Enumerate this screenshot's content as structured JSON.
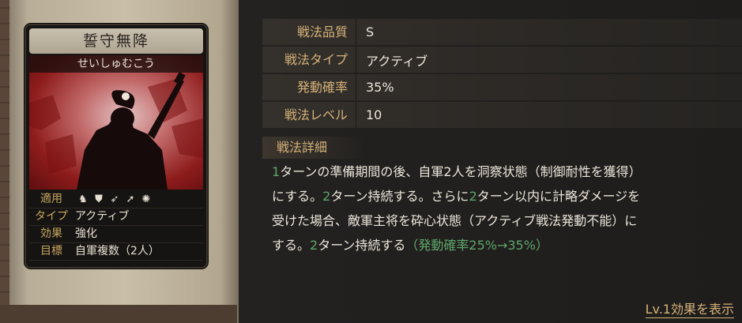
{
  "card": {
    "name": "誓守無降",
    "reading": "せいしゅむこう",
    "rows": [
      {
        "key": "適用",
        "icons": [
          "cavalry-icon",
          "shield-icon",
          "bow-icon",
          "spear-icon",
          "wheel-icon"
        ]
      },
      {
        "key": "タイプ",
        "value": "アクティブ"
      },
      {
        "key": "効果",
        "value": "強化"
      },
      {
        "key": "目標",
        "value": "自軍複数（2人）"
      }
    ]
  },
  "stats": [
    {
      "key": "戦法品質",
      "value": "S"
    },
    {
      "key": "戦法タイプ",
      "value": "アクティブ"
    },
    {
      "key": "発動確率",
      "value": "35%"
    },
    {
      "key": "戦法レベル",
      "value": "10"
    }
  ],
  "detail": {
    "heading": "戦法詳細",
    "segments": [
      {
        "text": "1",
        "hl": true
      },
      {
        "text": "ターンの準備期間の後、自軍2人を洞察状態（制御耐性を獲得）",
        "hl": false
      },
      {
        "text": "にする。",
        "hl": false
      },
      {
        "text": "2",
        "hl": true
      },
      {
        "text": "ターン持続する。さらに",
        "hl": false
      },
      {
        "text": "2",
        "hl": true
      },
      {
        "text": "ターン以内に計略ダメージを",
        "hl": false
      },
      {
        "text": "受けた場合、敵軍主将を砕心状態（アクティブ戦法発動不能）に",
        "hl": false
      },
      {
        "text": "する。",
        "hl": false
      },
      {
        "text": "2",
        "hl": true
      },
      {
        "text": "ターン持続する",
        "hl": false
      },
      {
        "text": "（発動確率25%→35%）",
        "hl": true
      }
    ]
  },
  "link": {
    "label": "Lv.1効果を表示"
  }
}
